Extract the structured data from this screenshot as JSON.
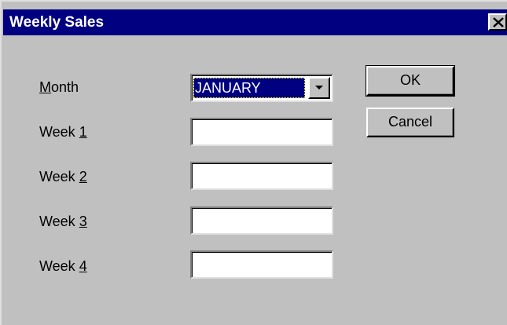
{
  "window": {
    "title": "Weekly Sales",
    "close_icon": "close-icon"
  },
  "form": {
    "month_label_mnemonic": "M",
    "month_label_rest": "onth",
    "month_value": "JANUARY",
    "weeks": [
      {
        "prefix": "Week ",
        "mnemonic": "1",
        "value": ""
      },
      {
        "prefix": "Week ",
        "mnemonic": "2",
        "value": ""
      },
      {
        "prefix": "Week ",
        "mnemonic": "3",
        "value": ""
      },
      {
        "prefix": "Week ",
        "mnemonic": "4",
        "value": ""
      }
    ]
  },
  "buttons": {
    "ok_label": "OK",
    "cancel_label": "Cancel"
  },
  "colors": {
    "titlebar": "#000080",
    "dialog_bg": "#c0c0c0",
    "selection": "#000080"
  }
}
